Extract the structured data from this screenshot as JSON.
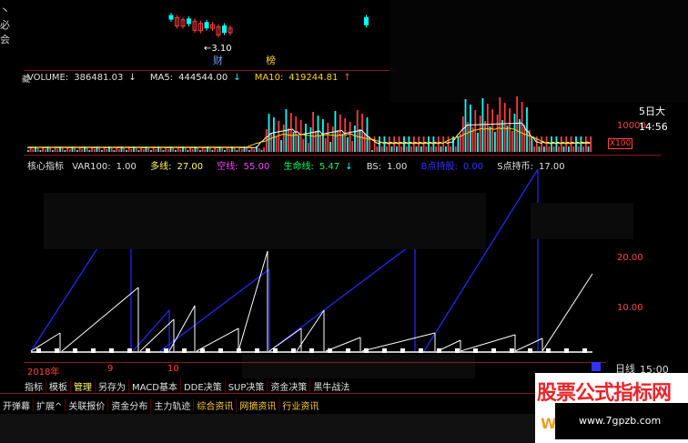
{
  "colors": {
    "up": "#ff3c3c",
    "down": "#00ffff",
    "ma5": "#ffffff",
    "ma10": "#ffd800",
    "frame": "#8b1a1a",
    "blue_line": "#2a2aff"
  },
  "top_chart": {
    "low_marker": "←3.10",
    "tag_cai": "财",
    "tag_bang": "榜"
  },
  "volume": {
    "label": "VOLUME:",
    "value": "386481.03",
    "value_arrow": "↓",
    "ma5_label": "MA5:",
    "ma5_value": "444544.00",
    "ma5_arrow": "↓",
    "ma10_label": "MA10:",
    "ma10_value": "419244.81",
    "ma10_arrow": "↑",
    "axis_label": "10000",
    "axis_unit": "X100",
    "right_top": "5日大",
    "time": "14:56"
  },
  "indicator": {
    "name": "核心指标",
    "items": [
      {
        "label": "VAR100:",
        "value": "1.00",
        "color": "#e0e0e0"
      },
      {
        "label": "多线:",
        "value": "27.00",
        "color": "#ffff66"
      },
      {
        "label": "空线:",
        "value": "55.00",
        "color": "#ff44ff"
      },
      {
        "label": "生命线:",
        "value": "5.47",
        "color": "#00ff66",
        "arrow": "↓"
      },
      {
        "label": "BS:",
        "value": "1.00",
        "color": "#e0e0e0"
      },
      {
        "label": "B点持股:",
        "value": "0.00",
        "color": "#3333ff"
      },
      {
        "label": "S点持币:",
        "value": "17.00",
        "color": "#e0e0e0"
      }
    ],
    "axis": [
      "20.00",
      "10.00"
    ]
  },
  "date_axis": {
    "labels": [
      "2018年",
      "9",
      "10"
    ],
    "period": "日线",
    "time": "15:00"
  },
  "toolbar1": [
    "指标",
    "模板",
    "管理",
    "另存为",
    "MACD基本",
    "DDE决策",
    "SUP决策",
    "资金决策",
    "黑牛战法"
  ],
  "toolbar2": [
    "开弹幕",
    "扩展^",
    "关联报价",
    "资金分布",
    "主力轨迹",
    "综合资讯",
    "网摘资讯",
    "行业资讯"
  ],
  "watermark": {
    "title": "股票公式指标网",
    "url": "www.7gpzb.com",
    "prefix": "W"
  }
}
